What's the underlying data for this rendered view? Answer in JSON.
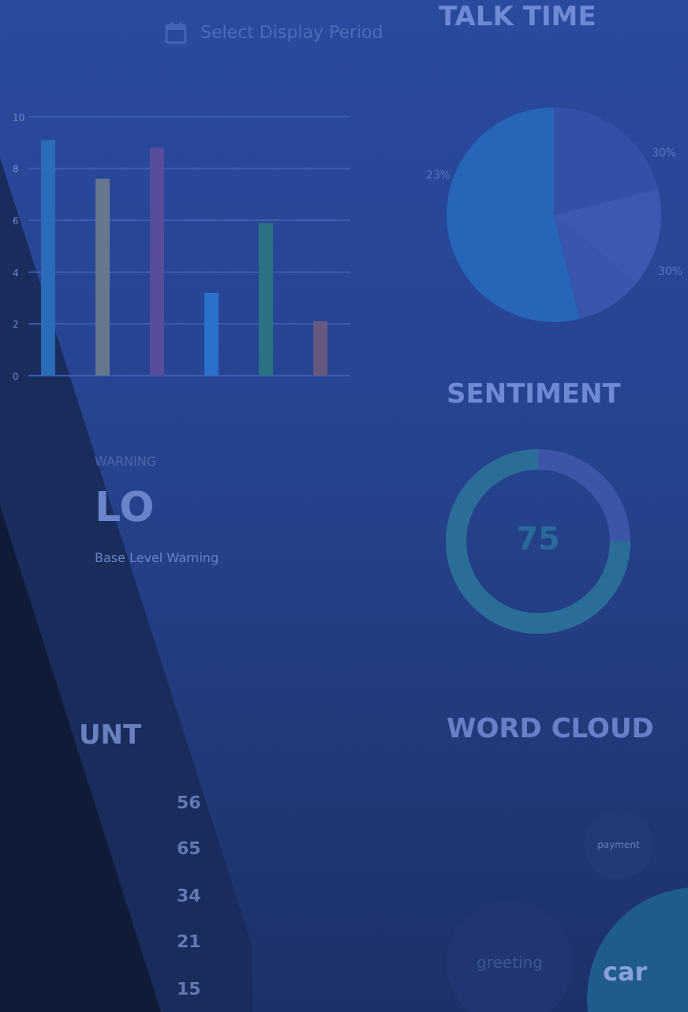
{
  "period_selector": {
    "label": "Select Display Period"
  },
  "bar_panel": {
    "chart_data": {
      "type": "bar",
      "values": [
        9.1,
        7.6,
        8.8,
        3.2,
        5.9,
        2.1
      ],
      "ylim": [
        0,
        10
      ],
      "yticks": [
        0,
        2,
        4,
        6,
        8,
        10
      ],
      "grid": true
    }
  },
  "warning": {
    "label": "WARNING",
    "value": "LO",
    "caption": "Base Level Warning"
  },
  "count": {
    "title": "UNT",
    "values": [
      "56",
      "65",
      "34",
      "21",
      "15"
    ]
  },
  "talk_time": {
    "title": "TALK TIME",
    "labels": [
      "23%",
      "30%",
      "30%"
    ]
  },
  "sentiment": {
    "title": "SENTIMENT",
    "value": "75"
  },
  "word_cloud": {
    "title": "WORD CLOUD",
    "words": [
      {
        "text": "payment",
        "kind": "small"
      },
      {
        "text": "greeting",
        "kind": "medium"
      },
      {
        "text": "car",
        "kind": "large"
      }
    ]
  }
}
